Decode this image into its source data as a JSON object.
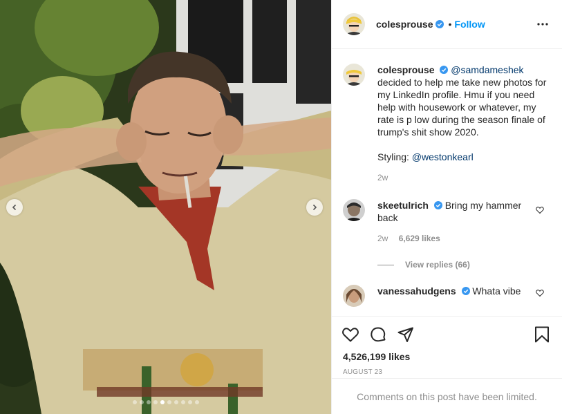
{
  "colors": {
    "accent": "#0095f6",
    "link": "#00376b",
    "muted": "#8e8e8e",
    "text": "#262626",
    "verified": "#3897f0"
  },
  "header": {
    "username": "colesprouse",
    "separator": "•",
    "follow_label": "Follow",
    "verified": true
  },
  "media": {
    "carousel_dots": 10,
    "active_dot": 5
  },
  "caption": {
    "username": "colesprouse",
    "mention": "@samdameshek",
    "text": "decided to help me take new photos for my LinkedIn profile. Hmu if you need help with housework or whatever, my rate is p low during the season finale of trump's shit show 2020.",
    "styling_label": "Styling:",
    "styling_mention": "@westonkearl",
    "time": "2w"
  },
  "comments": [
    {
      "username": "skeetulrich",
      "verified": true,
      "text": "Bring my hammer back",
      "time": "2w",
      "likes": "6,629 likes",
      "replies": "View replies (66)"
    },
    {
      "username": "vanessahudgens",
      "verified": true,
      "text": "Whata vibe"
    }
  ],
  "actions": {
    "like": "heart-icon",
    "comment": "comment-icon",
    "share": "share-icon",
    "save": "bookmark-icon"
  },
  "likes": "4,526,199 likes",
  "date": "AUGUST 23",
  "comments_limited": "Comments on this post have been limited."
}
